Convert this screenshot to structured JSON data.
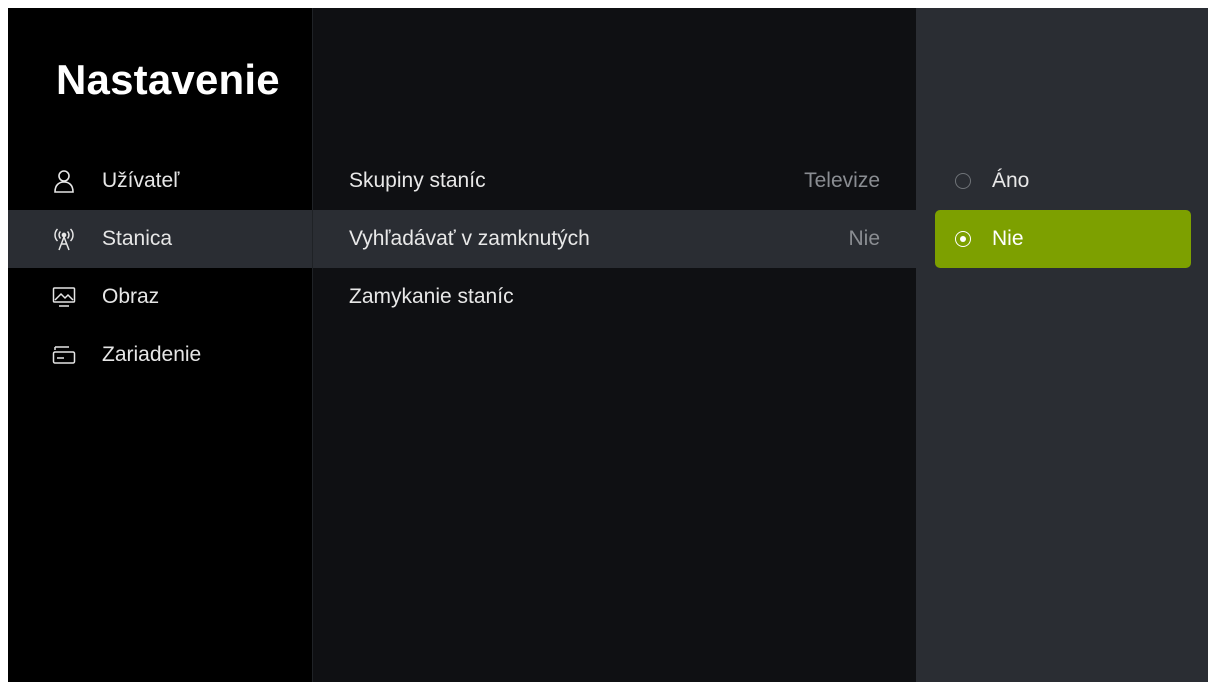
{
  "title": "Nastavenie",
  "sidebar": {
    "items": [
      {
        "label": "Užívateľ",
        "icon": "user-icon",
        "active": false
      },
      {
        "label": "Stanica",
        "icon": "antenna-icon",
        "active": true
      },
      {
        "label": "Obraz",
        "icon": "picture-icon",
        "active": false
      },
      {
        "label": "Zariadenie",
        "icon": "device-icon",
        "active": false
      }
    ]
  },
  "settings": {
    "rows": [
      {
        "label": "Skupiny staníc",
        "value": "Televize"
      },
      {
        "label": "Vyhľadávať v zamknutých",
        "value": "Nie"
      },
      {
        "label": "Zamykanie staníc",
        "value": ""
      }
    ]
  },
  "options": {
    "items": [
      {
        "label": "Áno",
        "selected": false
      },
      {
        "label": "Nie",
        "selected": true
      }
    ]
  },
  "colors": {
    "accent": "#7da000",
    "highlight": "#2a2d33",
    "background": "#000000",
    "panel": "#0f1013"
  }
}
